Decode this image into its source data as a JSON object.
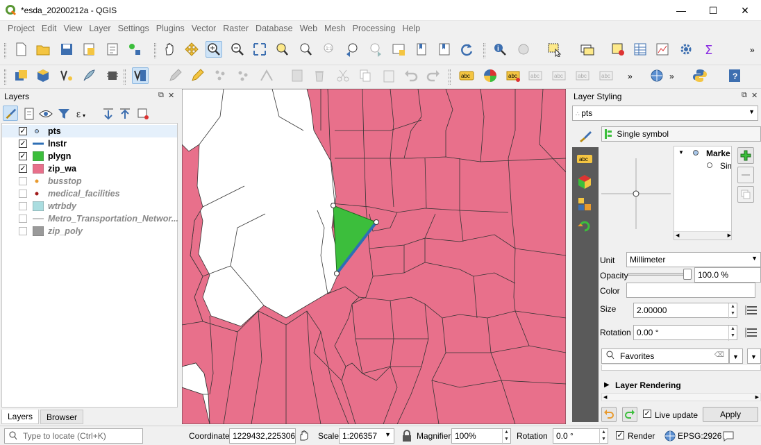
{
  "window": {
    "title": "*esda_20200212a - QGIS",
    "controls": {
      "minimize": "—",
      "maximize": "☐",
      "close": "✕"
    }
  },
  "menu": [
    "Project",
    "Edit",
    "View",
    "Layer",
    "Settings",
    "Plugins",
    "Vector",
    "Raster",
    "Database",
    "Web",
    "Mesh",
    "Processing",
    "Help"
  ],
  "layers_panel": {
    "title": "Layers",
    "layers": [
      {
        "name": "pts",
        "checked": true,
        "symbol": "point-icon"
      },
      {
        "name": "lnstr",
        "checked": true,
        "symbol": "line-icon"
      },
      {
        "name": "plygn",
        "checked": true,
        "symbol": "polygon-icon"
      },
      {
        "name": "zip_wa",
        "checked": true,
        "symbol": "polygon-icon"
      },
      {
        "name": "busstop",
        "checked": false,
        "symbol": "point-icon"
      },
      {
        "name": "medical_facilities",
        "checked": false,
        "symbol": "point-icon"
      },
      {
        "name": "wtrbdy",
        "checked": false,
        "symbol": "polygon-icon"
      },
      {
        "name": "Metro_Transportation_Networ...",
        "checked": false,
        "symbol": "line-icon"
      },
      {
        "name": "zip_poly",
        "checked": false,
        "symbol": "polygon-icon"
      }
    ],
    "tabs": [
      "Layers",
      "Browser"
    ]
  },
  "styling_panel": {
    "title": "Layer Styling",
    "layer_select": "pts",
    "renderer": "Single symbol",
    "tree": {
      "marker": "Marke",
      "simple": "Sim"
    },
    "unit_label": "Unit",
    "unit_value": "Millimeter",
    "opacity_label": "Opacity",
    "opacity_value": "100.0 %",
    "color_label": "Color",
    "size_label": "Size",
    "size_value": "2.00000",
    "rotation_label": "Rotation",
    "rotation_value": "0.00 °",
    "favorites_placeholder": "Favorites",
    "layer_rendering": "Layer Rendering",
    "live_update": "Live update",
    "apply": "Apply"
  },
  "statusbar": {
    "locate_placeholder": "Type to locate (Ctrl+K)",
    "coordinate_label": "Coordinate",
    "coordinate_value": "1229432,225306",
    "scale_label": "Scale",
    "scale_value": "1:206357",
    "magnifier_label": "Magnifier",
    "magnifier_value": "100%",
    "rotation_label": "Rotation",
    "rotation_value": "0.0 °",
    "render_label": "Render",
    "crs": "EPSG:2926"
  },
  "colors": {
    "zip_fill": "#e8708b",
    "polygon_fill": "#3cbe3c",
    "line": "#2e6fb5",
    "waterbody": "#aadde0",
    "zip_poly": "#9a9a9a"
  }
}
